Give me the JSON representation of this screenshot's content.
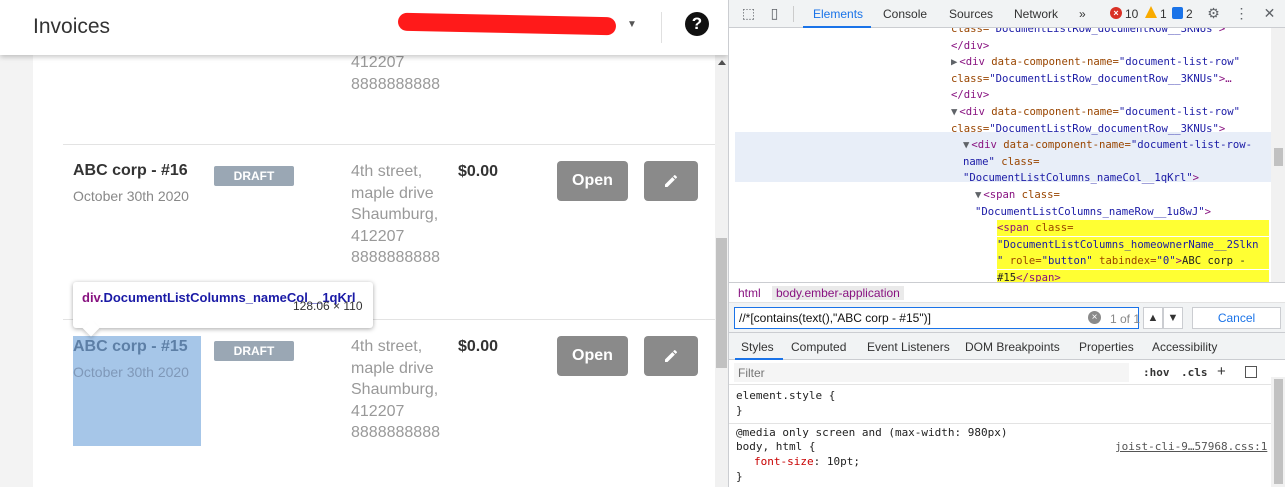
{
  "app": {
    "title": "Invoices",
    "partial_row": {
      "address_lines": [
        "412207",
        "8888888888"
      ]
    },
    "rows": [
      {
        "customer": "ABC corp - #16",
        "date": "October 30th 2020",
        "status": "DRAFT",
        "address_lines": [
          "4th street,",
          "maple drive",
          "Shaumburg,",
          "412207",
          "8888888888"
        ],
        "amount": "$0.00",
        "open_label": "Open"
      },
      {
        "customer": "ABC corp - #15",
        "date": "October 30th 2020",
        "status": "DRAFT",
        "address_lines": [
          "4th street,",
          "maple drive",
          "Shaumburg,",
          "412207",
          "8888888888"
        ],
        "amount": "$0.00",
        "open_label": "Open"
      }
    ],
    "tooltip": {
      "tag": "div",
      "selector": ".DocumentListColumns_nameCol__1qKrl",
      "size": "128.06 × 110"
    },
    "help_glyph": "?"
  },
  "devtools": {
    "tabs": [
      "Elements",
      "Console",
      "Sources",
      "Network"
    ],
    "more": "»",
    "errors": "10",
    "warnings": "1",
    "info": "2",
    "dom_lines": [
      {
        "indent": 222,
        "parts": [
          [
            "attr",
            "class="
          ],
          [
            "val",
            "\"DocumentListRow_documentRow__3KNUs\""
          ],
          [
            "tag",
            ">"
          ]
        ],
        "clipped": true
      },
      {
        "indent": 222,
        "parts": [
          [
            "tag",
            "</div>"
          ]
        ]
      },
      {
        "indent": 222,
        "parts": [
          [
            "tri",
            "▶"
          ],
          [
            "tag",
            "<div "
          ],
          [
            "attr",
            "data-component-name="
          ],
          [
            "val",
            "\"document-list-row\""
          ]
        ]
      },
      {
        "indent": 222,
        "parts": [
          [
            "attr",
            "class="
          ],
          [
            "val",
            "\"DocumentListRow_documentRow__3KNUs\""
          ],
          [
            "tag",
            ">…"
          ]
        ]
      },
      {
        "indent": 222,
        "parts": [
          [
            "tag",
            "</div>"
          ]
        ]
      },
      {
        "indent": 222,
        "parts": [
          [
            "tri",
            "▼"
          ],
          [
            "tag",
            "<div "
          ],
          [
            "attr",
            "data-component-name="
          ],
          [
            "val",
            "\"document-list-row\""
          ]
        ]
      },
      {
        "indent": 222,
        "parts": [
          [
            "attr",
            "class="
          ],
          [
            "val",
            "\"DocumentListRow_documentRow__3KNUs\""
          ],
          [
            "tag",
            ">"
          ]
        ]
      },
      {
        "indent": 234,
        "parts": [
          [
            "tri",
            "▼"
          ],
          [
            "tag",
            "<div "
          ],
          [
            "attr",
            "data-component-name="
          ],
          [
            "val",
            "\"document-list-row-"
          ]
        ]
      },
      {
        "indent": 234,
        "parts": [
          [
            "val",
            "name\""
          ],
          [
            "attr",
            " class="
          ]
        ]
      },
      {
        "indent": 234,
        "parts": [
          [
            "val",
            "\"DocumentListColumns_nameCol__1qKrl\""
          ],
          [
            "tag",
            ">"
          ]
        ]
      },
      {
        "indent": 246,
        "parts": [
          [
            "tri",
            "▼"
          ],
          [
            "tag",
            "<span "
          ],
          [
            "attr",
            "class="
          ]
        ]
      },
      {
        "indent": 246,
        "parts": [
          [
            "val",
            "\"DocumentListColumns_nameRow__1u8wJ\""
          ],
          [
            "tag",
            ">"
          ]
        ]
      },
      {
        "indent": 268,
        "parts": [
          [
            "tag",
            "<span "
          ],
          [
            "attr",
            "class="
          ]
        ],
        "yellow": true
      },
      {
        "indent": 268,
        "parts": [
          [
            "val",
            "\"DocumentListColumns_homeownerName__2Slkn"
          ]
        ],
        "yellow": true
      },
      {
        "indent": 268,
        "parts": [
          [
            "val",
            "\""
          ],
          [
            "attr",
            " role="
          ],
          [
            "val",
            "\"button\""
          ],
          [
            "attr",
            " tabindex="
          ],
          [
            "val",
            "\"0\""
          ],
          [
            "tag",
            ">"
          ],
          [
            "text",
            "ABC corp -"
          ]
        ],
        "yellow": true
      },
      {
        "indent": 268,
        "parts": [
          [
            "text",
            "#15"
          ],
          [
            "tag",
            "</span>"
          ]
        ],
        "yellow": true
      }
    ],
    "breadcrumbs": [
      "html",
      "body.ember-application"
    ],
    "search": {
      "value": "//*[contains(text(),\"ABC corp - #15\")]",
      "match": "1 of 1",
      "up": "▲",
      "down": "▼",
      "cancel": "Cancel"
    },
    "sub_tabs": [
      "Styles",
      "Computed",
      "Event Listeners",
      "DOM Breakpoints",
      "Properties",
      "Accessibility"
    ],
    "filter": {
      "placeholder": "Filter",
      "hov": ":hov",
      "cls": ".cls",
      "add": "+"
    },
    "styles": {
      "element_style": "element.style {",
      "close": "}",
      "media": "@media only screen and (max-width: 980px)",
      "selector": "body, html {",
      "source": "joist-cli-9…57968.css:1",
      "prop": "font-size",
      "value": "10pt;"
    }
  }
}
